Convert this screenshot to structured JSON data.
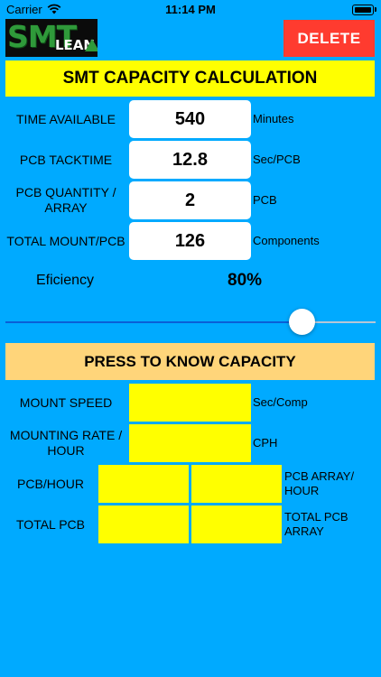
{
  "status": {
    "carrier": "Carrier",
    "time": "11:14 PM"
  },
  "logo": {
    "smt": "SMT",
    "lean": "LEAN"
  },
  "header": {
    "delete_label": "DELETE",
    "title": "SMT CAPACITY CALCULATION"
  },
  "inputs": {
    "time_available": {
      "label": "TIME AVAILABLE",
      "value": "540",
      "unit": "Minutes"
    },
    "pcb_tacktime": {
      "label": "PCB TACKTIME",
      "value": "12.8",
      "unit": "Sec/PCB"
    },
    "pcb_quantity": {
      "label": "PCB QUANTITY / ARRAY",
      "value": "2",
      "unit": "PCB"
    },
    "total_mount": {
      "label": "TOTAL MOUNT/PCB",
      "value": "126",
      "unit": "Components"
    }
  },
  "efficiency": {
    "label": "Eficiency",
    "value": "80%",
    "fraction": 0.8
  },
  "actions": {
    "press_label": "PRESS TO KNOW CAPACITY"
  },
  "results": {
    "mount_speed": {
      "label": "MOUNT SPEED",
      "unit": "Sec/Comp",
      "value": ""
    },
    "mounting_rate": {
      "label": "MOUNTING RATE / HOUR",
      "unit": "CPH",
      "value": ""
    },
    "pcb_hour": {
      "label": "PCB/HOUR",
      "value": "",
      "value2": "",
      "unit": "PCB ARRAY/ HOUR"
    },
    "total_pcb": {
      "label": "TOTAL PCB",
      "value": "",
      "value2": "",
      "unit": "TOTAL PCB ARRAY"
    }
  },
  "colors": {
    "background": "#00aaff",
    "title_bg": "#ffff00",
    "delete_bg": "#ff3b2f",
    "press_bg": "#ffd57a",
    "result_bg": "#ffff00"
  }
}
